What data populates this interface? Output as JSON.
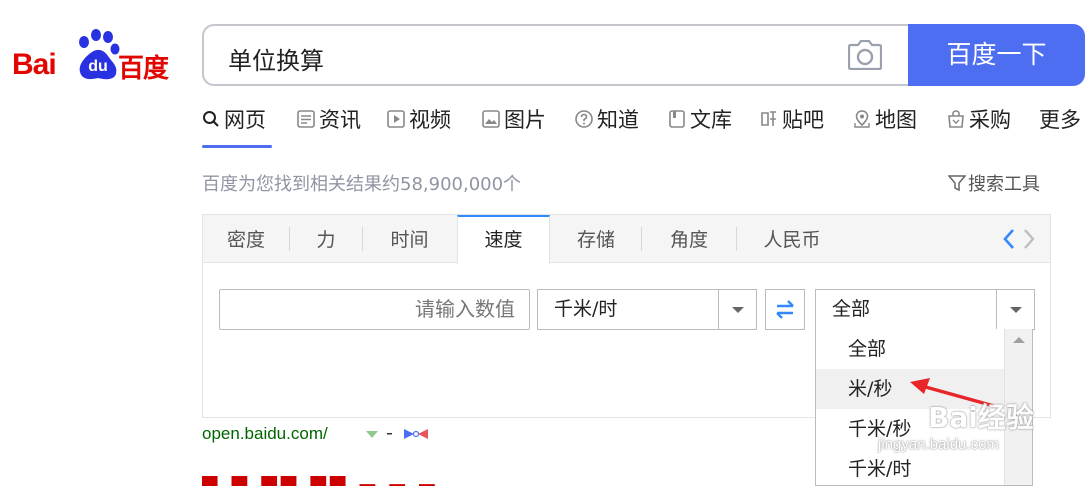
{
  "logo": {
    "part1": "Bai",
    "part2": "du",
    "part3": "百度"
  },
  "search": {
    "query": "单位换算",
    "button_label": "百度一下"
  },
  "nav": {
    "items": [
      {
        "label": "网页",
        "icon": "search-icon",
        "active": true
      },
      {
        "label": "资讯",
        "icon": "news-icon"
      },
      {
        "label": "视频",
        "icon": "video-icon"
      },
      {
        "label": "图片",
        "icon": "image-icon"
      },
      {
        "label": "知道",
        "icon": "question-icon"
      },
      {
        "label": "文库",
        "icon": "document-icon"
      },
      {
        "label": "贴吧",
        "icon": "tieba-icon"
      },
      {
        "label": "地图",
        "icon": "map-icon"
      },
      {
        "label": "采购",
        "icon": "shopping-icon"
      },
      {
        "label": "更多",
        "icon": ""
      }
    ]
  },
  "results": {
    "count_text": "百度为您找到相关结果约58,900,000个",
    "tools_label": "搜索工具"
  },
  "converter": {
    "tabs": [
      "密度",
      "力",
      "时间",
      "速度",
      "存储",
      "角度",
      "人民币"
    ],
    "active_tab": "速度",
    "value_placeholder": "请输入数值",
    "from_unit": "千米/时",
    "to_unit": "全部",
    "dropdown_options": [
      "全部",
      "米/秒",
      "千米/秒",
      "千米/时"
    ],
    "hover_option": "米/秒"
  },
  "result_link": {
    "url": "open.baidu.com/",
    "separator": "-"
  },
  "watermark": {
    "text": "Bai经验",
    "url": "jingyan.baidu.com"
  },
  "colors": {
    "brand_red": "#e10601",
    "brand_blue": "#4e6ef2",
    "link_green": "#006600",
    "tab_accent": "#3388ff"
  }
}
